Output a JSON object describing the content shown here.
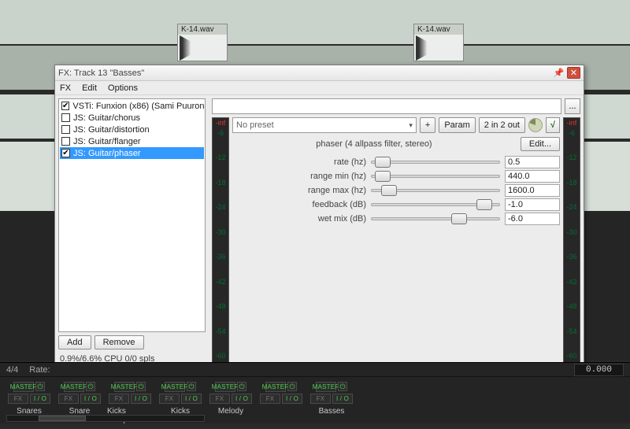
{
  "bg": {
    "clip1": "K-14.wav",
    "clip2": "K-14.wav"
  },
  "dialog": {
    "title": "FX: Track 13 \"Basses\"",
    "menu": {
      "fx": "FX",
      "edit": "Edit",
      "options": "Options"
    },
    "fx_items": [
      {
        "checked": true,
        "label": "VSTi: Funxion (x86) (Sami Puuron...",
        "selected": false
      },
      {
        "checked": false,
        "label": "JS: Guitar/chorus",
        "selected": false
      },
      {
        "checked": false,
        "label": "JS: Guitar/distortion",
        "selected": false
      },
      {
        "checked": false,
        "label": "JS: Guitar/flanger",
        "selected": false
      },
      {
        "checked": true,
        "label": "JS: Guitar/phaser",
        "selected": true
      }
    ],
    "add": "Add",
    "remove": "Remove",
    "cpu": "0.9%/6.6% CPU 0/0 spls",
    "browse": "...",
    "preset": "No preset",
    "plus": "+",
    "param_btn": "Param",
    "io_btn": "2 in 2 out",
    "ui_btn": "√",
    "fx_title": "phaser (4 allpass filter, stereo)",
    "edit_btn": "Edit...",
    "params": [
      {
        "label": "rate (hz)",
        "value": "0.5",
        "pos": 0.03
      },
      {
        "label": "range min (hz)",
        "value": "440.0",
        "pos": 0.03
      },
      {
        "label": "range max (hz)",
        "value": "1600.0",
        "pos": 0.08
      },
      {
        "label": "feedback (dB)",
        "value": "-1.0",
        "pos": 0.82
      },
      {
        "label": "wet mix (dB)",
        "value": "-6.0",
        "pos": 0.62
      }
    ],
    "meter": {
      "inf": "-inf",
      "ticks": [
        "-6",
        "-12",
        "-18",
        "-24",
        "-30",
        "-36",
        "-42",
        "-48",
        "-54",
        "-60"
      ]
    }
  },
  "bottom": {
    "sig": "4/4",
    "rate_lbl": "Rate:",
    "pos": "0.000",
    "channels": [
      {
        "name": "Snares"
      },
      {
        "name": "Snare"
      },
      {
        "name": "Kicks Samples"
      },
      {
        "name": "Kicks"
      },
      {
        "name": "Melody"
      },
      {
        "name": ""
      },
      {
        "name": "Basses"
      }
    ],
    "chip_master": "MASTER",
    "chip_fx": "FX",
    "chip_io": "I / O"
  }
}
